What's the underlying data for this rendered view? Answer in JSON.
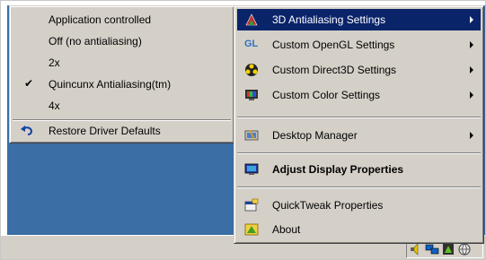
{
  "antialias_menu": {
    "items": [
      {
        "label": "Application controlled"
      },
      {
        "label": "Off (no antialiasing)"
      },
      {
        "label": "2x"
      },
      {
        "label": "Quincunx Antialiasing(tm)",
        "checked": true
      },
      {
        "label": "4x"
      }
    ],
    "restore_label": "Restore Driver Defaults"
  },
  "tray_menu": {
    "items": [
      {
        "label": "3D Antialiasing Settings",
        "icon": "nvidia-3d-icon",
        "submenu": true,
        "highlighted": true
      },
      {
        "label": "Custom OpenGL Settings",
        "icon": "opengl-icon",
        "icon_text": "GL",
        "submenu": true
      },
      {
        "label": "Custom Direct3D Settings",
        "icon": "direct3d-icon",
        "submenu": true
      },
      {
        "label": "Custom Color Settings",
        "icon": "monitor-color-icon",
        "submenu": true
      },
      {
        "label": "Desktop Manager",
        "icon": "desktop-manager-icon",
        "submenu": true
      },
      {
        "label": "Adjust Display Properties",
        "icon": "display-properties-icon",
        "bold": true
      },
      {
        "label": "QuickTweak Properties",
        "icon": "quicktweak-icon"
      },
      {
        "label": "About",
        "icon": "about-icon"
      }
    ]
  },
  "colors": {
    "menu_bg": "#d4d0c8",
    "highlight_bg": "#0a246a",
    "highlight_text": "#ffffff",
    "desktop_bg": "#3a6ea5"
  },
  "tray_icons": [
    "speaker-icon",
    "network-icon",
    "nvidia-tray-icon",
    "globe-icon"
  ]
}
